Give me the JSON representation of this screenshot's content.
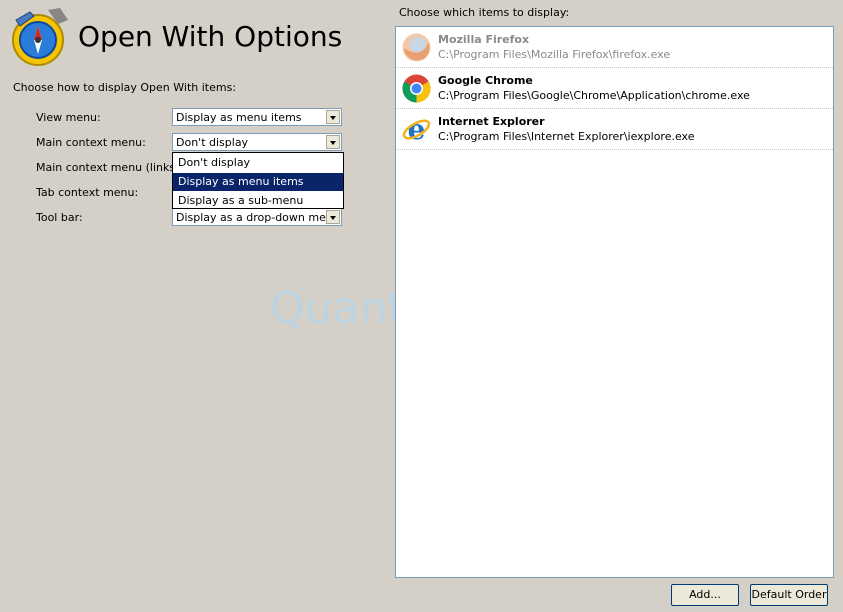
{
  "header": {
    "title": "Open With Options"
  },
  "left": {
    "heading": "Choose how to display Open With items:",
    "rows": [
      {
        "label": "View menu:",
        "value": "Display as menu items"
      },
      {
        "label": "Main context menu:",
        "value": "Don't display"
      },
      {
        "label": "Main context menu (links):",
        "value": ""
      },
      {
        "label": "Tab context menu:",
        "value": ""
      },
      {
        "label": "Tool bar:",
        "value": "Display as a drop-down menu"
      }
    ],
    "dropdown_options": [
      "Don't display",
      "Display as menu items",
      "Display as a sub-menu"
    ],
    "dropdown_highlighted": "Display as menu items"
  },
  "right": {
    "heading": "Choose which items to display:",
    "items": [
      {
        "name": "Mozilla Firefox",
        "path": "C:\\Program Files\\Mozilla Firefox\\firefox.exe",
        "icon": "firefox-icon",
        "enabled": false
      },
      {
        "name": "Google Chrome",
        "path": "C:\\Program Files\\Google\\Chrome\\Application\\chrome.exe",
        "icon": "chrome-icon",
        "enabled": true
      },
      {
        "name": "Internet Explorer",
        "path": "C:\\Program Files\\Internet Explorer\\iexplore.exe",
        "icon": "internet-explorer-icon",
        "enabled": true
      }
    ]
  },
  "buttons": {
    "add": "Add...",
    "default_order": "Default Order"
  },
  "watermark": "Quantrimang"
}
